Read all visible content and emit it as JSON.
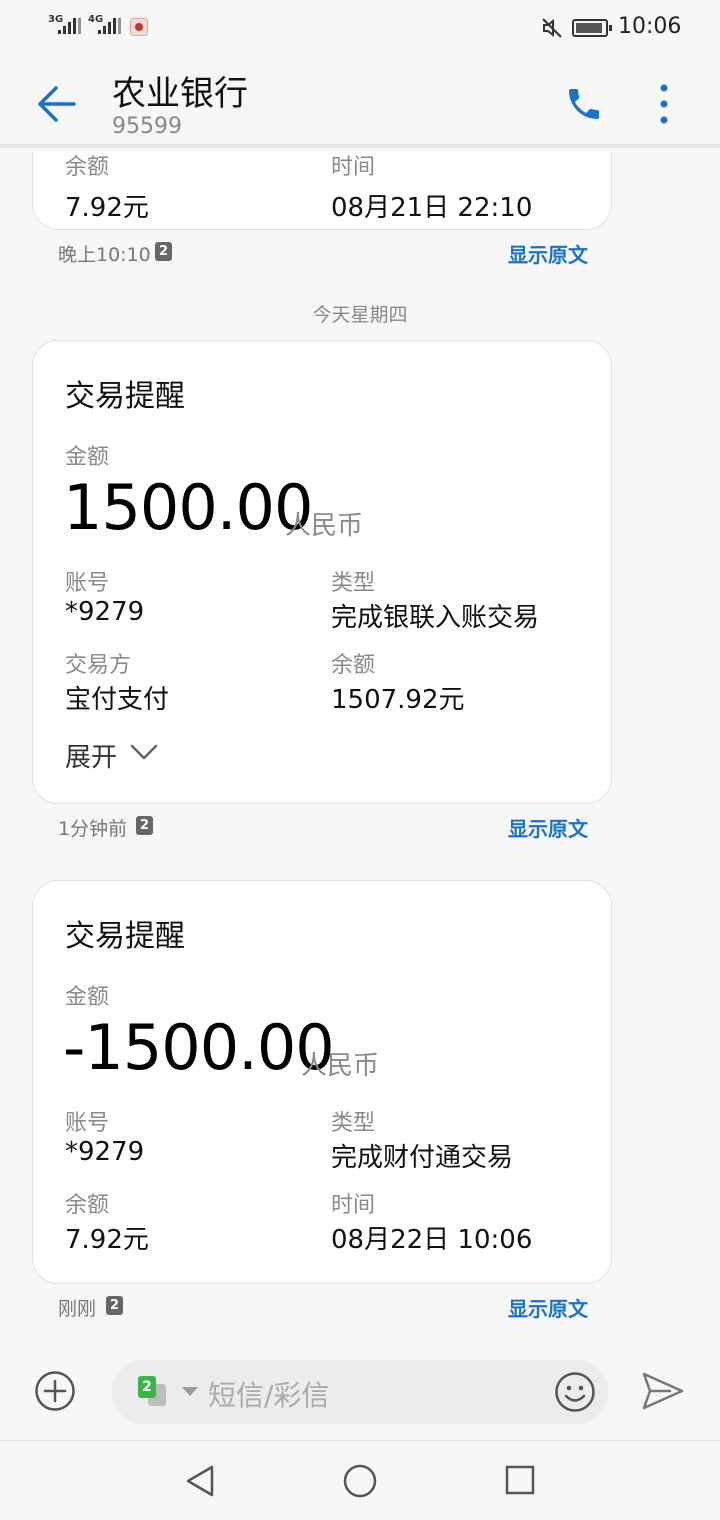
{
  "status_bar": {
    "signal1_label": "3G",
    "signal2_label": "4G",
    "time": "10:06"
  },
  "header": {
    "title": "农业银行",
    "subtitle": "95599"
  },
  "messages": {
    "partial_card": {
      "label_left": "余额",
      "value_left": "7.92元",
      "label_right": "时间",
      "value_right": "08月21日 22:10",
      "timestamp": "晚上10:10",
      "sim": "2",
      "show_original": "显示原文"
    },
    "day_separator": "今天星期四",
    "card1": {
      "title": "交易提醒",
      "amount_label": "金额",
      "amount": "1500.00",
      "currency": "人民币",
      "account_label": "账号",
      "account": "*9279",
      "type_label": "类型",
      "type": "完成银联入账交易",
      "counterparty_label": "交易方",
      "counterparty": "宝付支付",
      "balance_label": "余额",
      "balance": "1507.92元",
      "expand": "展开",
      "timestamp": "1分钟前",
      "sim": "2",
      "show_original": "显示原文"
    },
    "card2": {
      "title": "交易提醒",
      "amount_label": "金额",
      "amount": "-1500.00",
      "currency": "人民币",
      "account_label": "账号",
      "account": "*9279",
      "type_label": "类型",
      "type": "完成财付通交易",
      "balance_label": "余额",
      "balance": "7.92元",
      "time_label": "时间",
      "time": "08月22日 10:06",
      "timestamp": "刚刚",
      "sim": "2",
      "show_original": "显示原文"
    }
  },
  "composer": {
    "sim_number": "2",
    "placeholder": "短信/彩信"
  },
  "colors": {
    "accent_blue": "#1a73c9",
    "sim_green": "#3bb44a",
    "background": "#f7f7f7"
  }
}
